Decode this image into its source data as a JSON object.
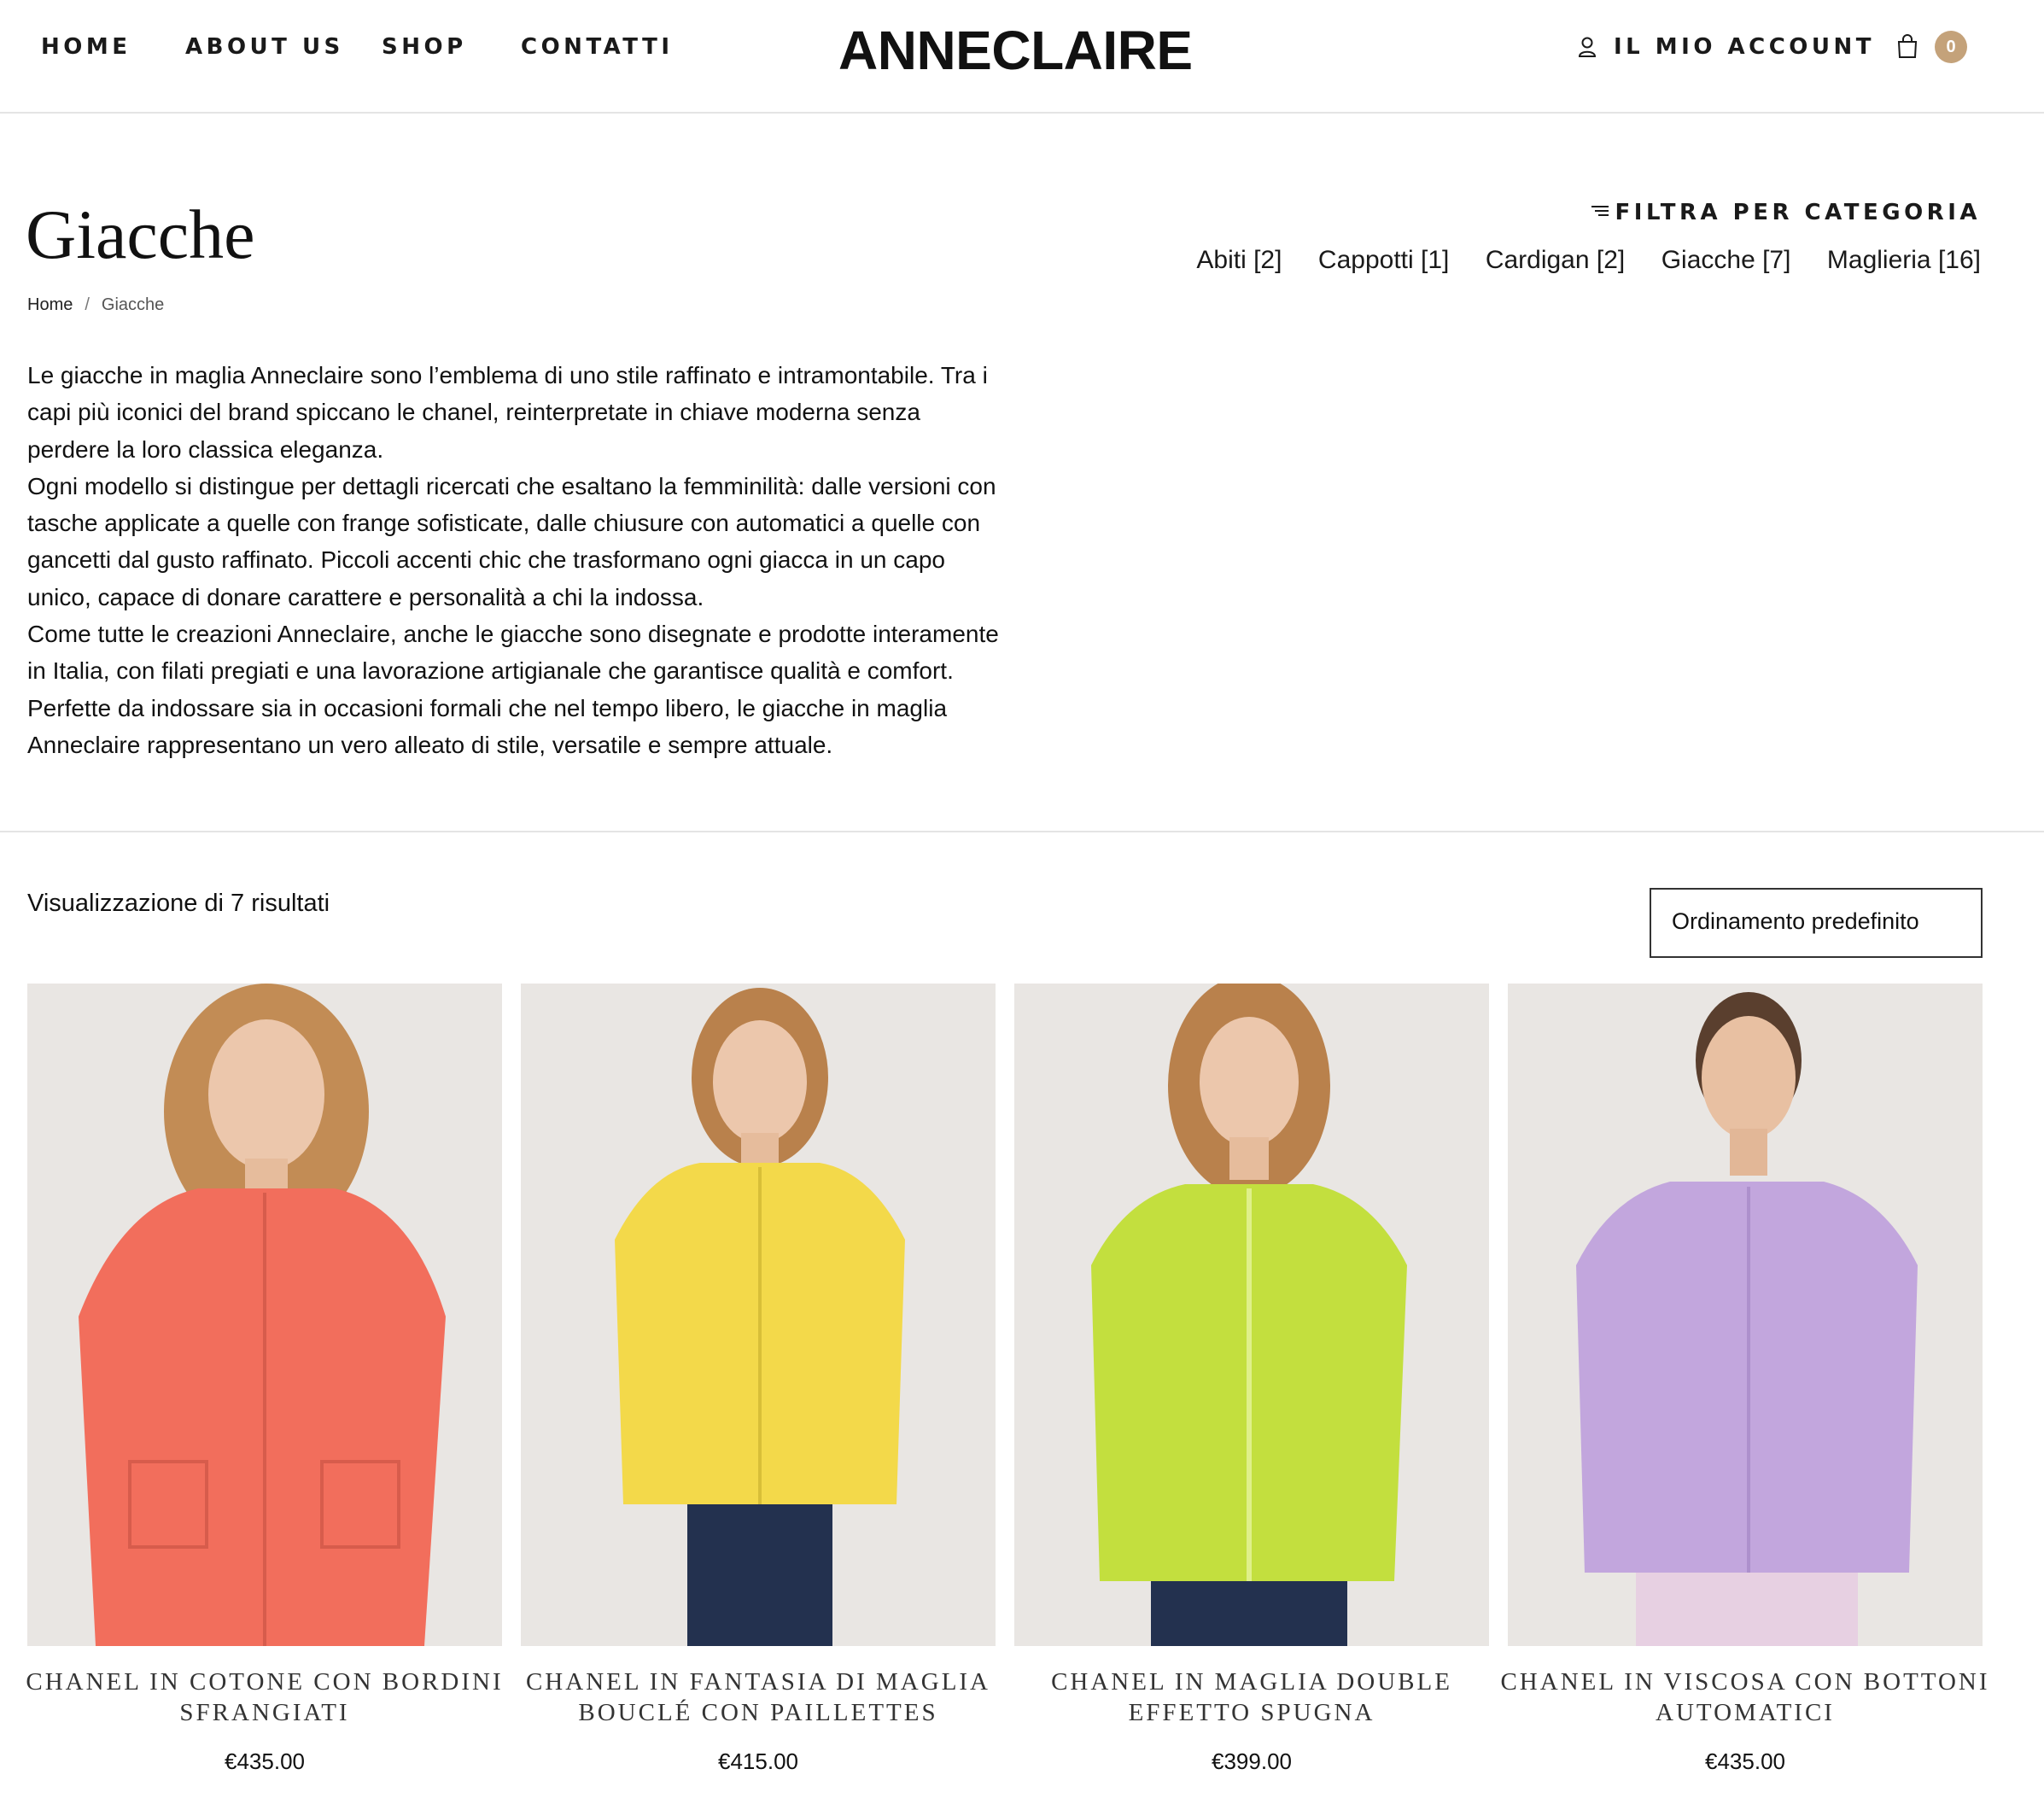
{
  "header": {
    "nav": [
      {
        "label": "HOME"
      },
      {
        "label": "ABOUT US"
      },
      {
        "label": "SHOP"
      },
      {
        "label": "CONTATTI"
      }
    ],
    "logo": "ANNECLAIRE",
    "account_label": "IL MIO ACCOUNT",
    "cart_count": "0"
  },
  "page": {
    "title": "Giacche",
    "breadcrumb": {
      "home": "Home",
      "separator": "/",
      "current": "Giacche"
    },
    "filter_heading": "FILTRA PER CATEGORIA",
    "categories": [
      {
        "label": "Abiti [2]"
      },
      {
        "label": "Cappotti [1]"
      },
      {
        "label": "Cardigan [2]"
      },
      {
        "label": "Giacche [7]"
      },
      {
        "label": "Maglieria [16]"
      }
    ],
    "description": [
      "Le giacche in maglia Anneclaire sono l’emblema di uno stile raffinato e intramontabile. Tra i capi più iconici del brand spiccano le chanel, reinterpretate in chiave moderna senza perdere la loro classica eleganza.",
      "Ogni modello si distingue per dettagli ricercati che esaltano la femminilità: dalle versioni con tasche applicate a quelle con frange sofisticate, dalle chiusure con automatici a quelle con gancetti dal gusto raffinato. Piccoli accenti chic che trasformano ogni giacca in un capo unico, capace di donare carattere e personalità a chi la indossa.",
      "Come tutte le creazioni Anneclaire, anche le giacche sono disegnate e prodotte interamente in Italia, con filati pregiati e una lavorazione artigianale che garantisce qualità e comfort. Perfette da indossare sia in occasioni formali che nel tempo libero, le giacche in maglia Anneclaire rappresentano un vero alleato di stile, versatile e sempre attuale."
    ]
  },
  "toolbar": {
    "result_count": "Visualizzazione di 7 risultati",
    "sort_label": "Ordinamento predefinito"
  },
  "products": [
    {
      "name": "CHANEL IN COTONE CON BORDINI SFRANGIATI",
      "price": "€435.00",
      "color": "#f26e5c"
    },
    {
      "name": "CHANEL IN FANTASIA DI MAGLIA BOUCLÉ CON PAILLETTES",
      "price": "€415.00",
      "color": "#f3d94a"
    },
    {
      "name": "CHANEL IN MAGLIA DOUBLE EFFETTO SPUGNA",
      "price": "€399.00",
      "color": "#c3df3e"
    },
    {
      "name": "CHANEL IN VISCOSA CON BOTTONI AUTOMATICI",
      "price": "€435.00",
      "color": "#c2a6dd"
    }
  ],
  "colors": {
    "accent_badge": "#c4a27a",
    "photo_background": "#e9e6e3"
  },
  "icons": {
    "account": "user-icon",
    "cart": "shopping-bag-icon",
    "filter": "filter-lines-icon"
  }
}
